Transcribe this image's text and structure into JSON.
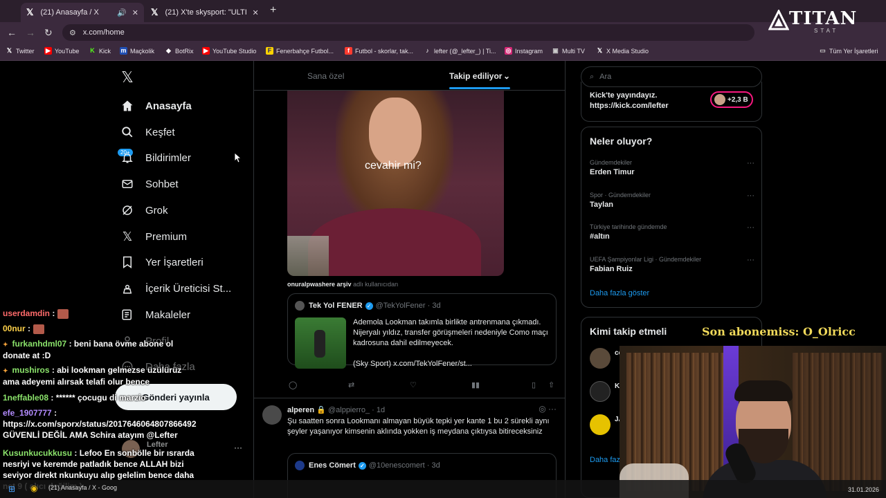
{
  "browser": {
    "tabs": [
      {
        "title": "(21) Anasayfa / X",
        "active": true
      },
      {
        "title": "(21) X'te skysport: \"ULTIM'ORA",
        "active": false
      }
    ],
    "url": "x.com/home",
    "bookmarks": [
      {
        "label": "Twitter",
        "icon": "x-logo-icon"
      },
      {
        "label": "YouTube",
        "icon": "youtube-icon"
      },
      {
        "label": "Kick",
        "icon": "kick-icon"
      },
      {
        "label": "Maçkolik",
        "icon": "mackolik-icon"
      },
      {
        "label": "BotRix",
        "icon": "botrix-icon"
      },
      {
        "label": "YouTube Studio",
        "icon": "youtube-studio-icon"
      },
      {
        "label": "Fenerbahçe Futbol...",
        "icon": "fenerbahce-icon"
      },
      {
        "label": "Futbol - skorlar, tak...",
        "icon": "flashscore-icon"
      },
      {
        "label": "lefter (@_lefter_) | Ti...",
        "icon": "tiktok-icon"
      },
      {
        "label": "Instagram",
        "icon": "instagram-icon"
      },
      {
        "label": "Multi TV",
        "icon": "multitv-icon"
      },
      {
        "label": "X Media Studio",
        "icon": "x-logo-icon"
      }
    ],
    "all_bookmarks": "Tüm Yer İşaretleri"
  },
  "sidebar": {
    "items": [
      {
        "label": "Anasayfa",
        "icon": "home-icon"
      },
      {
        "label": "Keşfet",
        "icon": "search-icon"
      },
      {
        "label": "Bildirimler",
        "icon": "bell-icon"
      },
      {
        "label": "Sohbet",
        "icon": "mail-icon"
      },
      {
        "label": "Grok",
        "icon": "grok-icon"
      },
      {
        "label": "Premium",
        "icon": "x-logo-icon"
      },
      {
        "label": "Yer İşaretleri",
        "icon": "bookmark-icon"
      },
      {
        "label": "İçerik Üreticisi St...",
        "icon": "creator-icon"
      },
      {
        "label": "Makaleler",
        "icon": "article-icon"
      },
      {
        "label": "Profil",
        "icon": "profile-icon"
      },
      {
        "label": "Daha fazla",
        "icon": "more-icon"
      }
    ],
    "notif_badge": "20+",
    "post_button": "Gönderi yayınla",
    "account_name": "Lefter"
  },
  "feed": {
    "tabs": [
      "Sana özel",
      "Takip ediliyor"
    ],
    "media_caption": "cevahir mi?",
    "source_user": "onuralpwashere arşiv",
    "source_suffix": "adlı kullanıcıdan",
    "quote": {
      "name": "Tek Yol FENER",
      "handle": "@TekYolFener · 3d",
      "text": "Ademola Lookman takımla birlikte antrenmana çıkmadı. Nijeryalı yıldız, transfer görüşmeleri nedeniyle Como maçı kadrosuna dahil edilmeyecek.",
      "text2": "(Sky Sport)  x.com/TekYolFener/st..."
    },
    "post2": {
      "name": "alperen",
      "handle": "@alppierro_ · 1d",
      "text": "Şu saatten sonra Lookmanı almayan büyük tepki yer kante 1 bu 2 sürekli aynı şeyler yaşanıyor kimsenin aklında yokken iş meydana çıktıysa bitireceksiniz",
      "quote_name": "Enes Cömert",
      "quote_handle": "@10enescomert · 3d"
    }
  },
  "right": {
    "search_placeholder": "Ara",
    "kick_text1": "Kick'te yayındayız.",
    "kick_text2": "https://kick.com/lefter",
    "follower_count": "+2,3 B",
    "trends_title": "Neler oluyor?",
    "trends": [
      {
        "context": "Gündemdekiler",
        "name": "Erden Timur"
      },
      {
        "context": "Spor · Gündemdekiler",
        "name": "Taylan"
      },
      {
        "context": "Türkiye tarihinde gündemde",
        "name": "#altın"
      },
      {
        "context": "UEFA Şampiyonlar Ligi · Gündemdekiler",
        "name": "Fabian Ruiz"
      }
    ],
    "show_more": "Daha fazla göster",
    "who_title": "Kimi takip etmeli",
    "who": [
      "cc",
      "K",
      "JA"
    ],
    "who_more": "Daha faz"
  },
  "stream": {
    "chat": [
      {
        "user": "userdamdin",
        "color": "#ff6b6b",
        "msg": ":",
        "emote": true
      },
      {
        "user": "00nur",
        "color": "#ffd24a",
        "msg": ":",
        "emote": true
      },
      {
        "user": "furkanhdml07",
        "color": "#8be36b",
        "msg": ": beni bana övme abone ol donate at :D",
        "star": true
      },
      {
        "user": "mushiros",
        "color": "#8be36b",
        "msg": ": abi lookman gelmezse üzülürüz ama adeyemi alırsak telafi olur bence",
        "star": true
      },
      {
        "user": "1neffable08",
        "color": "#8be36b",
        "msg": ": ****** çocugu di marzio"
      },
      {
        "user": "efe_1907777",
        "color": "#b48cff",
        "msg": ": https://x.com/sporx/status/2017646064807866492 GÜVENLİ DEĞİL AMA Schira atayım @Lefter"
      },
      {
        "user": "Kusunkucukkusu",
        "color": "#8be36b",
        "msg": ": Lefoo En sonbölle bir ısrarda nesriyi ve keremde patladık bence ALLAH bizi seviyor direkt nkunkuyu alıp gelelim bence daha net 9 ( alıcı değilim )"
      }
    ],
    "subscriber_label": "Son abonemiss: O_Olricc",
    "logo_text": "TITAN",
    "logo_sub": "STAT",
    "taskbar_item": "(21) Anasayfa / X - Goog",
    "taskbar_date": "31.01.2026"
  }
}
